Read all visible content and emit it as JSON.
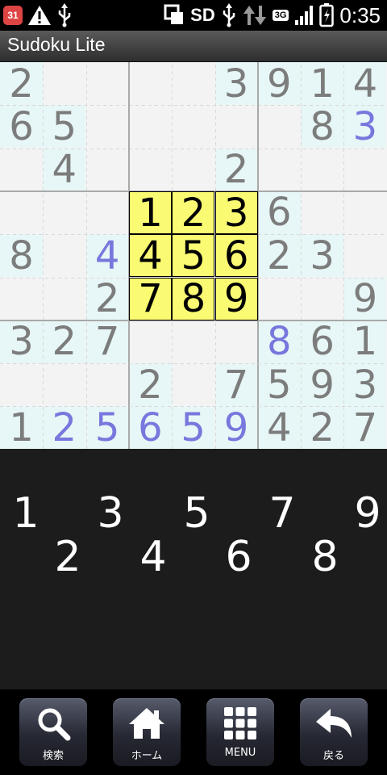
{
  "status_bar": {
    "calendar_badge": "31",
    "storage_label": "SD",
    "network_type": "3G",
    "time": "0:35"
  },
  "app": {
    "title": "Sudoku Lite"
  },
  "colors": {
    "given_digit": "#7c7c7c",
    "entered_digit": "#7777dd",
    "highlight_cell": "#e7f6f6",
    "number_pad": "#fbfb73"
  },
  "board": {
    "rows": [
      [
        "2",
        "",
        "",
        "",
        "",
        "3",
        "9",
        "1",
        "4"
      ],
      [
        "6",
        "5",
        "",
        "",
        "",
        "",
        "",
        "8",
        "3"
      ],
      [
        "",
        "4",
        "",
        "",
        "",
        "2",
        "",
        "",
        ""
      ],
      [
        "",
        "",
        "",
        "",
        "",
        "",
        "6",
        "",
        ""
      ],
      [
        "8",
        "",
        "4",
        "",
        "",
        "",
        "2",
        "3",
        ""
      ],
      [
        "",
        "",
        "2",
        "",
        "",
        "",
        "",
        "",
        "9"
      ],
      [
        "3",
        "2",
        "7",
        "",
        "",
        "",
        "8",
        "6",
        "1"
      ],
      [
        "",
        "",
        "",
        "2",
        "",
        "7",
        "5",
        "9",
        "3"
      ],
      [
        "1",
        "2",
        "5",
        "6",
        "5",
        "9",
        "4",
        "2",
        "7"
      ]
    ],
    "entered": [
      [
        false,
        false,
        false,
        false,
        false,
        false,
        false,
        false,
        false
      ],
      [
        false,
        false,
        false,
        false,
        false,
        false,
        false,
        false,
        true
      ],
      [
        false,
        false,
        false,
        false,
        false,
        false,
        false,
        false,
        false
      ],
      [
        false,
        false,
        false,
        false,
        false,
        false,
        false,
        false,
        false
      ],
      [
        false,
        false,
        true,
        false,
        false,
        false,
        false,
        false,
        false
      ],
      [
        false,
        false,
        false,
        false,
        false,
        false,
        false,
        false,
        false
      ],
      [
        false,
        false,
        false,
        false,
        false,
        false,
        true,
        false,
        false
      ],
      [
        false,
        false,
        false,
        false,
        false,
        false,
        false,
        false,
        false
      ],
      [
        false,
        true,
        true,
        true,
        true,
        true,
        false,
        false,
        false
      ]
    ],
    "highlighted": [
      [
        true,
        false,
        false,
        false,
        false,
        true,
        true,
        true,
        true
      ],
      [
        true,
        true,
        false,
        false,
        false,
        false,
        false,
        true,
        true
      ],
      [
        false,
        true,
        false,
        false,
        false,
        true,
        false,
        false,
        false
      ],
      [
        false,
        false,
        false,
        false,
        false,
        false,
        true,
        false,
        false
      ],
      [
        true,
        false,
        true,
        false,
        false,
        false,
        true,
        true,
        false
      ],
      [
        false,
        false,
        true,
        false,
        false,
        false,
        false,
        false,
        true
      ],
      [
        true,
        true,
        true,
        false,
        false,
        false,
        true,
        true,
        true
      ],
      [
        false,
        false,
        false,
        true,
        false,
        true,
        true,
        true,
        true
      ],
      [
        true,
        true,
        true,
        true,
        true,
        true,
        true,
        true,
        true
      ]
    ]
  },
  "number_pad_overlay": [
    "1",
    "2",
    "3",
    "4",
    "5",
    "6",
    "7",
    "8",
    "9"
  ],
  "picker": {
    "top_row": [
      "1",
      "3",
      "5",
      "7",
      "9"
    ],
    "bottom_row": [
      "2",
      "4",
      "6",
      "8"
    ]
  },
  "nav": {
    "search_label": "検索",
    "home_label": "ホーム",
    "menu_label": "MENU",
    "back_label": "戻る"
  }
}
